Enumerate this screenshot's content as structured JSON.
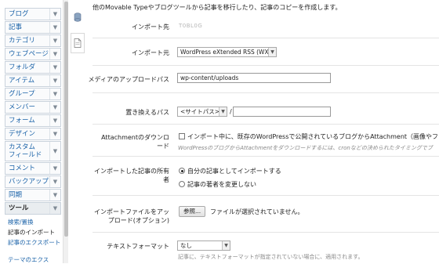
{
  "sidebar": {
    "items": [
      {
        "label": "ブログ"
      },
      {
        "label": "記事"
      },
      {
        "label": "カテゴリ"
      },
      {
        "label": "ウェブページ"
      },
      {
        "label": "フォルダ"
      },
      {
        "label": "アイテム"
      },
      {
        "label": "グループ"
      },
      {
        "label": "メンバー"
      },
      {
        "label": "フォーム"
      },
      {
        "label": "デザイン"
      },
      {
        "label_line1": "カスタム",
        "label_line2": "フィールド"
      },
      {
        "label": "コメント"
      },
      {
        "label": "バックアップ"
      },
      {
        "label": "同期"
      },
      {
        "label": "ツール"
      }
    ],
    "sub_items": [
      {
        "label": "検索/置換"
      },
      {
        "label": "記事のインポート"
      },
      {
        "label": "記事のエクスポート"
      },
      {
        "label": "テーマのエクス"
      }
    ]
  },
  "main": {
    "intro": "他のMovable Typeやブログツールから記事を移行したり、記事のコピーを作成します。",
    "import_dest": {
      "label": "インポート先",
      "value": "T0BL0G"
    },
    "import_source": {
      "label": "インポート元",
      "value": "WordPress eXtended RSS (WXR)"
    },
    "upload_path": {
      "label": "メディアのアップロードパス",
      "value": "wp-content/uploads"
    },
    "replace_path": {
      "label": "置き換えるパス",
      "select_value": "<サイトパス>",
      "separator": "/",
      "input_value": ""
    },
    "attachment": {
      "label_line1": "Attachmentのダウンロ",
      "label_line2": "ード",
      "checkbox_label": "インポート中に、既存のWordPressで公開されているブログからAttachment（画像やファイ",
      "hint": "WordPressのブログからAttachmentをダウンロードするには、cronなどの決められたタイミングでブ"
    },
    "owner": {
      "label_line1": "インポートした記事の所有",
      "label_line2": "者",
      "option1": "自分の記事としてインポートする",
      "option2": "記事の著者を変更しない"
    },
    "upload_file": {
      "label_line1": "インポートファイルをアッ",
      "label_line2": "プロード(オプション)",
      "button": "参照...",
      "status": "ファイルが選択されていません。"
    },
    "text_format": {
      "label": "テキストフォーマット",
      "value": "なし",
      "hint": "記事に、テキストフォーマットが指定されていない場合に、適用されます。"
    }
  }
}
